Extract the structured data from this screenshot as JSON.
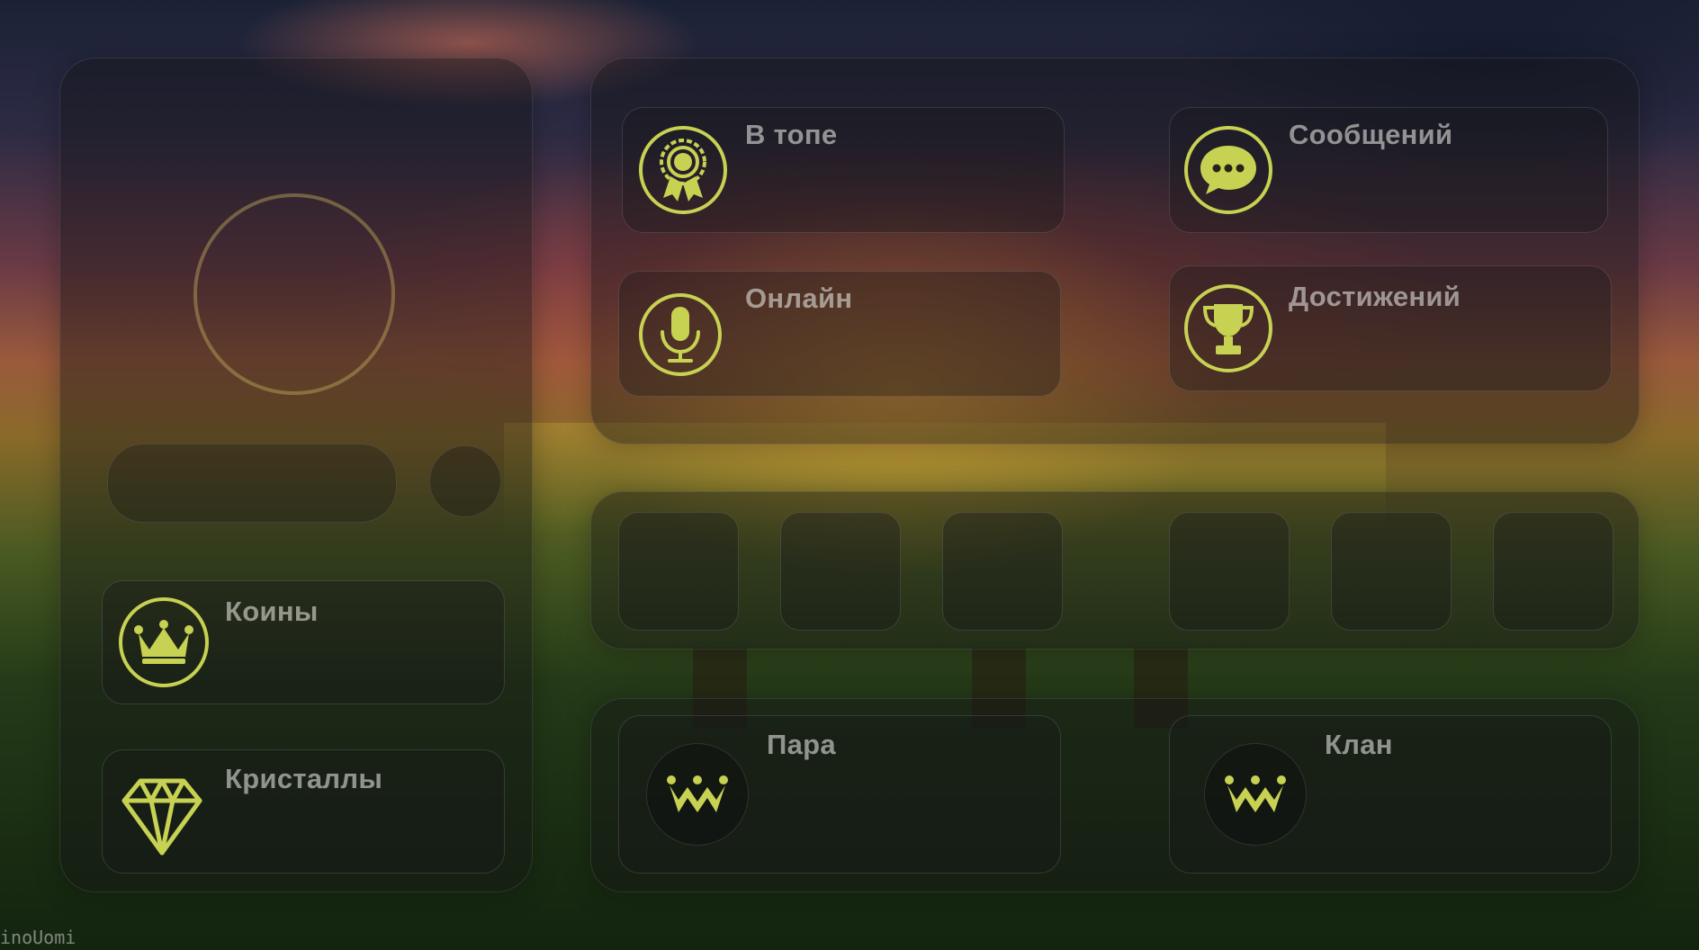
{
  "theme": {
    "accent": "#c7d152"
  },
  "stats": {
    "top": {
      "label": "В топе",
      "icon": "award-icon"
    },
    "messages": {
      "label": "Сообщений",
      "icon": "chat-bubble-icon"
    },
    "online": {
      "label": "Онлайн",
      "icon": "microphone-icon"
    },
    "achievements": {
      "label": "Достижений",
      "icon": "trophy-icon"
    }
  },
  "currency": {
    "coins": {
      "label": "Коины",
      "icon": "crown-icon"
    },
    "crystals": {
      "label": "Кристаллы",
      "icon": "diamond-icon"
    }
  },
  "relations": {
    "pair": {
      "label": "Пара",
      "icon": "crown-logo-icon"
    },
    "clan": {
      "label": "Клан",
      "icon": "crown-logo-icon"
    }
  },
  "watermark": "inoUomi"
}
